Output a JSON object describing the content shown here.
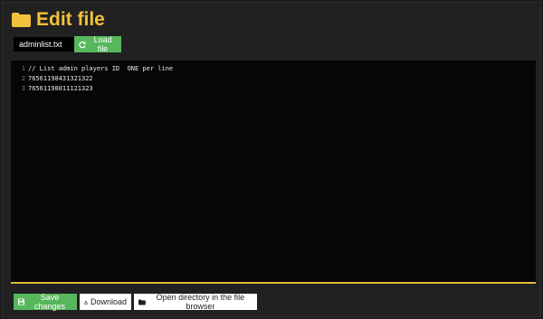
{
  "header": {
    "title": "Edit file",
    "icon": "folder-icon"
  },
  "file": {
    "name": "adminlist.txt"
  },
  "toolbar": {
    "load_label": "Load file"
  },
  "editor": {
    "lines": [
      {
        "num": "1",
        "text": "// List admin players ID  ONE per line"
      },
      {
        "num": "2",
        "text": "76561198431321322"
      },
      {
        "num": "3",
        "text": "76561198011121323"
      }
    ]
  },
  "actions": {
    "save_label": "Save changes",
    "download_label": "Download",
    "open_dir_label": "Open directory in the file browser"
  },
  "colors": {
    "accent": "#f2c13d",
    "success": "#57b75c",
    "underline": "#e0b93a"
  }
}
